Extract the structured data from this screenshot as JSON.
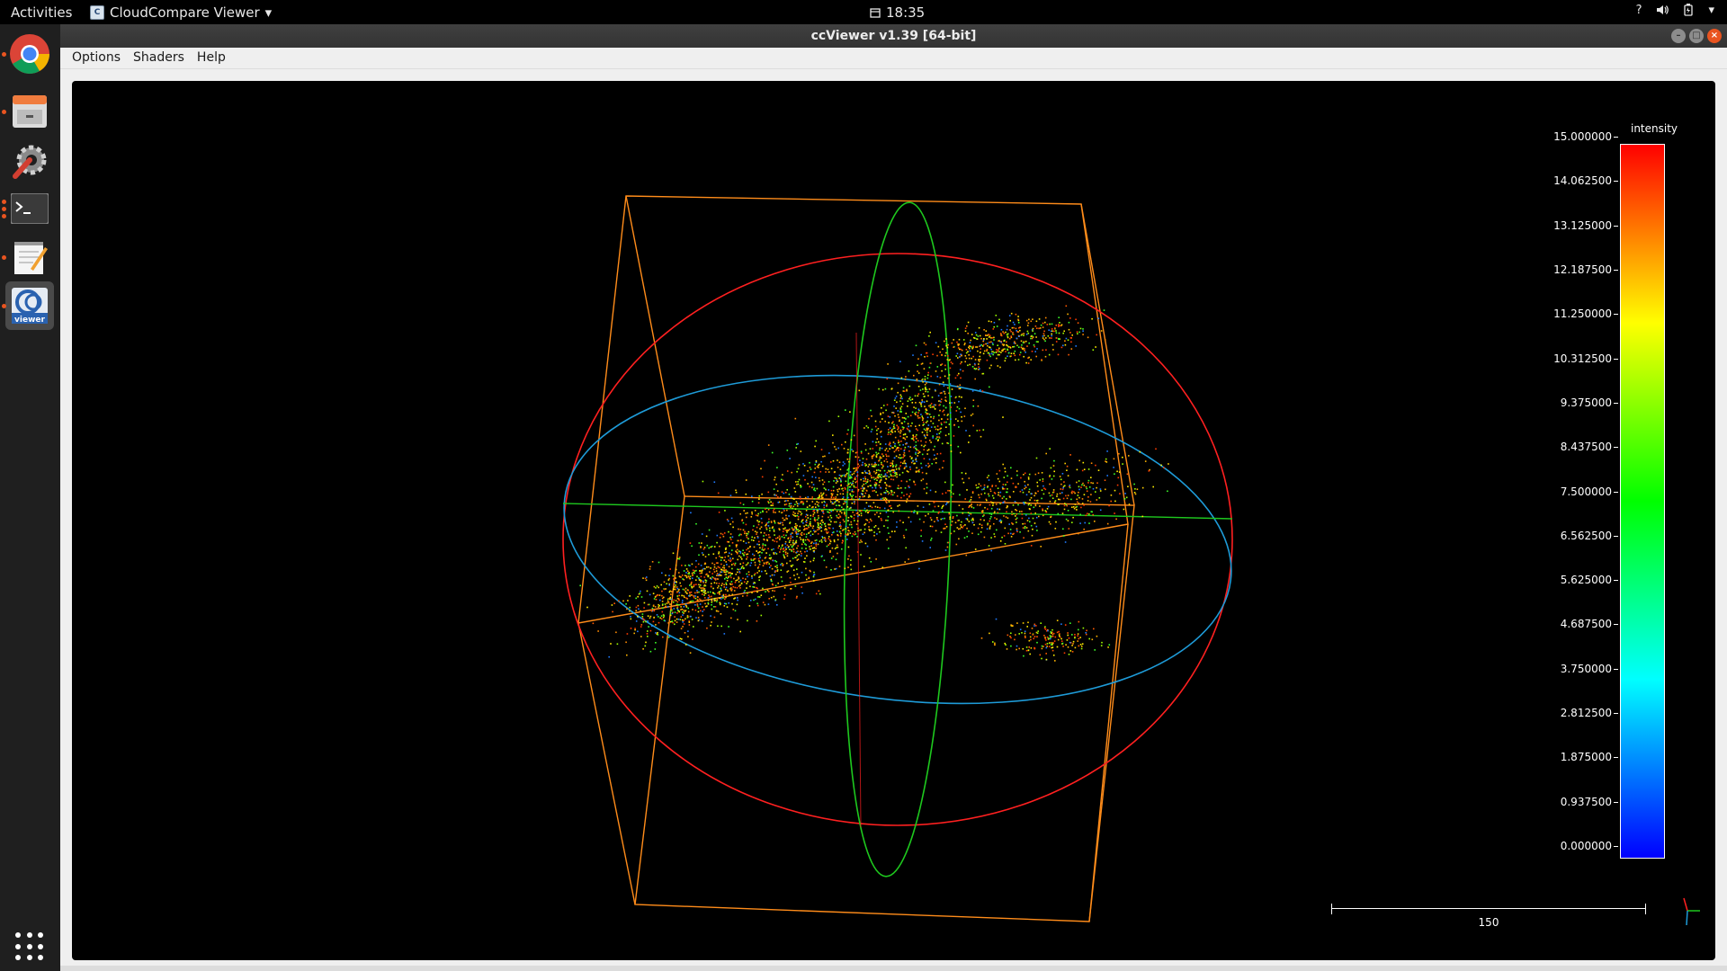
{
  "topbar": {
    "activities": "Activities",
    "app_name": "CloudCompare Viewer",
    "app_menu_arrow": "▾",
    "clock": "18:35",
    "tray_icons": [
      "help-icon",
      "volume-icon",
      "power-icon",
      "menu-arrow-icon"
    ]
  },
  "dock": {
    "items": [
      {
        "name": "chrome-icon"
      },
      {
        "name": "files-icon"
      },
      {
        "name": "settings-icon"
      },
      {
        "name": "terminal-icon"
      },
      {
        "name": "text-editor-icon"
      },
      {
        "name": "ccviewer-icon",
        "label": "viewer"
      }
    ]
  },
  "window": {
    "title": "ccViewer v1.39 [64-bit]",
    "menu": {
      "options": "Options",
      "shaders": "Shaders",
      "help": "Help"
    }
  },
  "viewer": {
    "scalar_field_name": "intensity",
    "scale_labels": [
      "15.000000",
      "14.062500",
      "13.125000",
      "12.187500",
      "11.250000",
      "10.312500",
      "9.375000",
      "8.437500",
      "7.500000",
      "6.562500",
      "5.625000",
      "4.687500",
      "3.750000",
      "2.812500",
      "1.875000",
      "0.937500",
      "0.000000"
    ],
    "scale_range": [
      0,
      15
    ],
    "colormap": [
      "#0000ff",
      "#00ffff",
      "#00ff00",
      "#ffff00",
      "#ff0000"
    ],
    "ruler_label": "150",
    "colors": {
      "bbox": "#ff8c1a",
      "circle_x": "#ff2020",
      "circle_y": "#1ec81e",
      "circle_z": "#1e9bd8"
    }
  }
}
